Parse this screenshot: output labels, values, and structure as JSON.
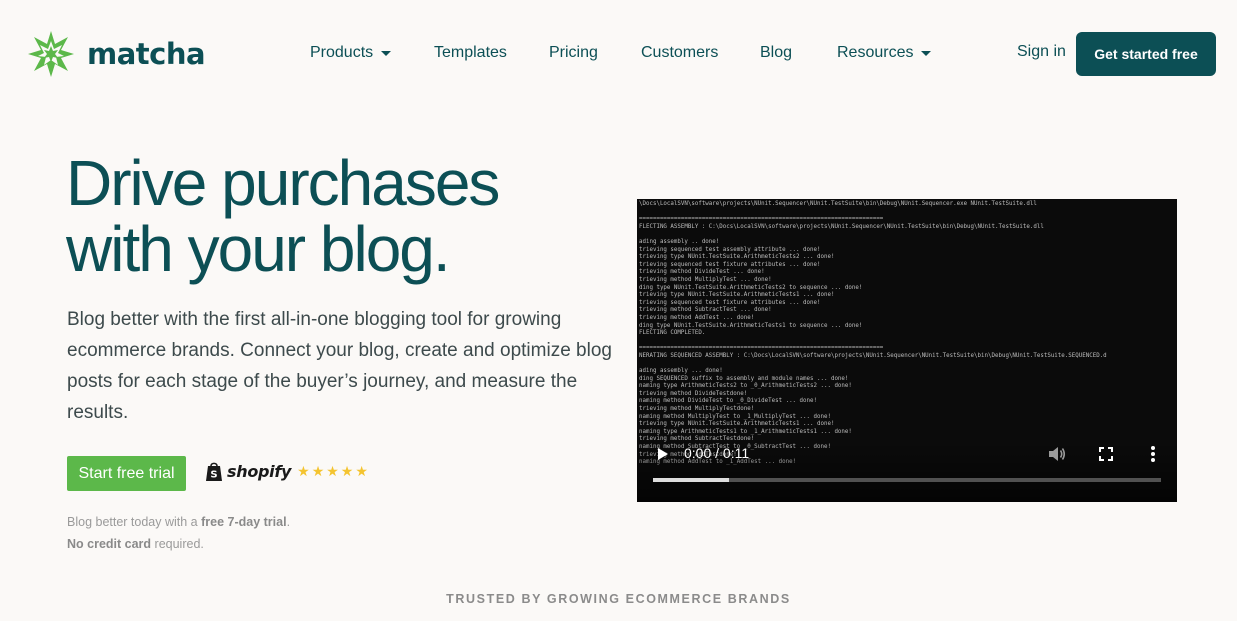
{
  "brand": {
    "name": "matcha",
    "logo_icon": "matcha-leaf-logo"
  },
  "nav": {
    "items": [
      {
        "label": "Products",
        "has_dropdown": true
      },
      {
        "label": "Templates",
        "has_dropdown": false
      },
      {
        "label": "Pricing",
        "has_dropdown": false
      },
      {
        "label": "Customers",
        "has_dropdown": false
      },
      {
        "label": "Blog",
        "has_dropdown": false
      },
      {
        "label": "Resources",
        "has_dropdown": true
      }
    ],
    "signin_label": "Sign in",
    "cta_label": "Get started free"
  },
  "hero": {
    "headline_line1": "Drive purchases",
    "headline_line2": "with your blog.",
    "subtext": "Blog better with the first all-in-one blogging tool for growing ecommerce brands. Connect your blog, create and optimize blog posts for each stage of the buyer’s journey, and measure the results.",
    "trial_button": "Start free trial",
    "partner_name": "shopify",
    "rating_stars": "★★★★★",
    "note_line1_a": "Blog better today with a ",
    "note_line1_b": "free 7-day trial",
    "note_line1_c": ".",
    "note_line2_a": "No credit card",
    "note_line2_b": " required."
  },
  "video": {
    "time_display": "0:00 / 0:11",
    "progress_fraction": 0.15,
    "console_lines": [
      "\\Docs\\LocalSVN\\software\\projects\\NUnit.Sequencer\\NUnit.TestSuite\\bin\\Debug\\NUnit.Sequencer.exe NUnit.TestSuite.dll",
      "",
      "======================================================================",
      "FLECTING ASSEMBLY : C:\\Docs\\LocalSVN\\software\\projects\\NUnit.Sequencer\\NUnit.TestSuite\\bin\\Debug\\NUnit.TestSuite.dll",
      "",
      "ading assembly .. done!",
      "trieving sequenced test assembly attribute ... done!",
      "trieving type NUnit.TestSuite.ArithmeticTests2 ... done!",
      "trieving sequenced test fixture attributes ... done!",
      "trieving method DivideTest ... done!",
      "trieving method MultiplyTest ... done!",
      "ding type NUnit.TestSuite.ArithmeticTests2 to sequence ... done!",
      "trieving type NUnit.TestSuite.ArithmeticTests1 ... done!",
      "trieving sequenced test fixture attributes ... done!",
      "trieving method SubtractTest ... done!",
      "trieving method AddTest ... done!",
      "ding type NUnit.TestSuite.ArithmeticTests1 to sequence ... done!",
      "FLECTING COMPLETED.",
      "",
      "======================================================================",
      "NERATING SEQUENCED ASSEMBLY : C:\\Docs\\LocalSVN\\software\\projects\\NUnit.Sequencer\\NUnit.TestSuite\\bin\\Debug\\NUnit.TestSuite.SEQUENCED.d",
      "",
      "ading assembly ... done!",
      "ding SEQUENCED suffix to assembly and module names ... done!",
      "naming type ArithmeticTests2 to _0_ArithmeticTests2 ... done!",
      "trieving method DivideTestdone!",
      "naming method DivideTest to _0_DivideTest ... done!",
      "trieving method MultiplyTestdone!",
      "naming method MultiplyTest to _1_MultiplyTest ... done!",
      "trieving type NUnit.TestSuite.ArithmeticTests1 ... done!",
      "naming type ArithmeticTests1 to _1_ArithmeticTests1 ... done!",
      "trieving method SubtractTestdone!",
      "naming method SubtractTest to _0_SubtractTest ... done!",
      "trieving method AddTestdone!",
      "naming method AddTest to _1_AddTest ... done!"
    ]
  },
  "trusted_label": "TRUSTED BY GROWING ECOMMERCE BRANDS",
  "colors": {
    "primary": "#0c4f55",
    "trial_green": "#5cb84a",
    "logo_green": "#5cb84a",
    "star_yellow": "#f4c430"
  }
}
